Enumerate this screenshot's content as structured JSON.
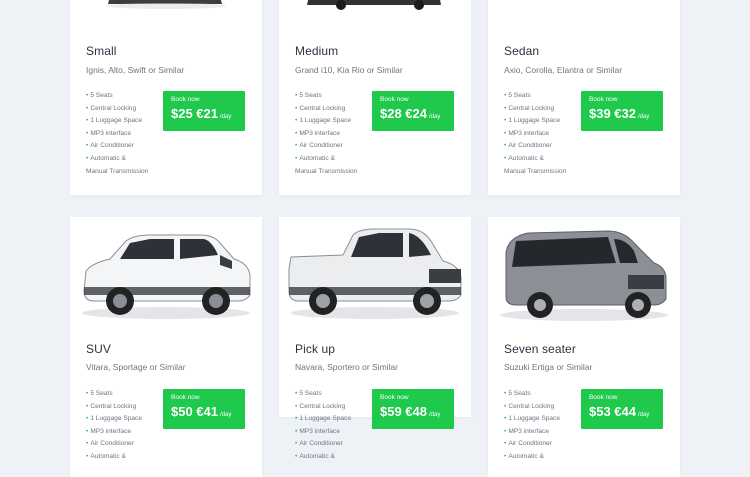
{
  "cars": [
    {
      "name": "Small",
      "models": "Ignis, Alto, Swift or Similar",
      "features": [
        "5 Seats",
        "Central Locking",
        "1 Luggage Space",
        "MP3 interface",
        "Air Conditioner",
        "Automatic &"
      ],
      "features_cont": "Manual Transmission",
      "book_label": "Book now",
      "price": "$25 €21",
      "per_day": "/day"
    },
    {
      "name": "Medium",
      "models": "Grand i10, Kia Rio or Similar",
      "features": [
        "5 Seats",
        "Central Locking",
        "1 Luggage Space",
        "MP3 interface",
        "Air Conditioner",
        "Automatic &"
      ],
      "features_cont": "Manual Transmission",
      "book_label": "Book now",
      "price": "$28 €24",
      "per_day": "/day"
    },
    {
      "name": "Sedan",
      "models": "Axio, Corolla, Elantra or Similar",
      "features": [
        "5 Seats",
        "Central Locking",
        "1 Luggage Space",
        "MP3 interface",
        "Air Conditioner",
        "Automatic &"
      ],
      "features_cont": "Manual Transmission",
      "book_label": "Book now",
      "price": "$39 €32",
      "per_day": "/day"
    },
    {
      "name": "SUV",
      "models": "Vitara, Sportage or Similar",
      "features": [
        "5 Seats",
        "Central Locking",
        "1 Luggage Space",
        "MP3 interface",
        "Air Conditioner",
        "Automatic &"
      ],
      "book_label": "Book now",
      "price": "$50 €41",
      "per_day": "/day"
    },
    {
      "name": "Pick up",
      "models": "Navara, Sportero or Similar",
      "features": [
        "5 Seats",
        "Central Locking",
        "1 Luggage Space",
        "MP3 interface",
        "Air Conditioner",
        "Automatic &"
      ],
      "book_label": "Book now",
      "price": "$59 €48",
      "per_day": "/day"
    },
    {
      "name": "Seven seater",
      "models": "Suzuki Ertiga or Similar",
      "features": [
        "5 Seats",
        "Central Locking",
        "1 Luggage Space",
        "MP3 interface",
        "Air Conditioner",
        "Automatic &"
      ],
      "book_label": "Book now",
      "price": "$53 €44",
      "per_day": "/day"
    }
  ],
  "colors": {
    "accent": "#1ec94b",
    "bullet": "#2ebd4e",
    "background": "#eef2f6",
    "card": "#ffffff"
  }
}
